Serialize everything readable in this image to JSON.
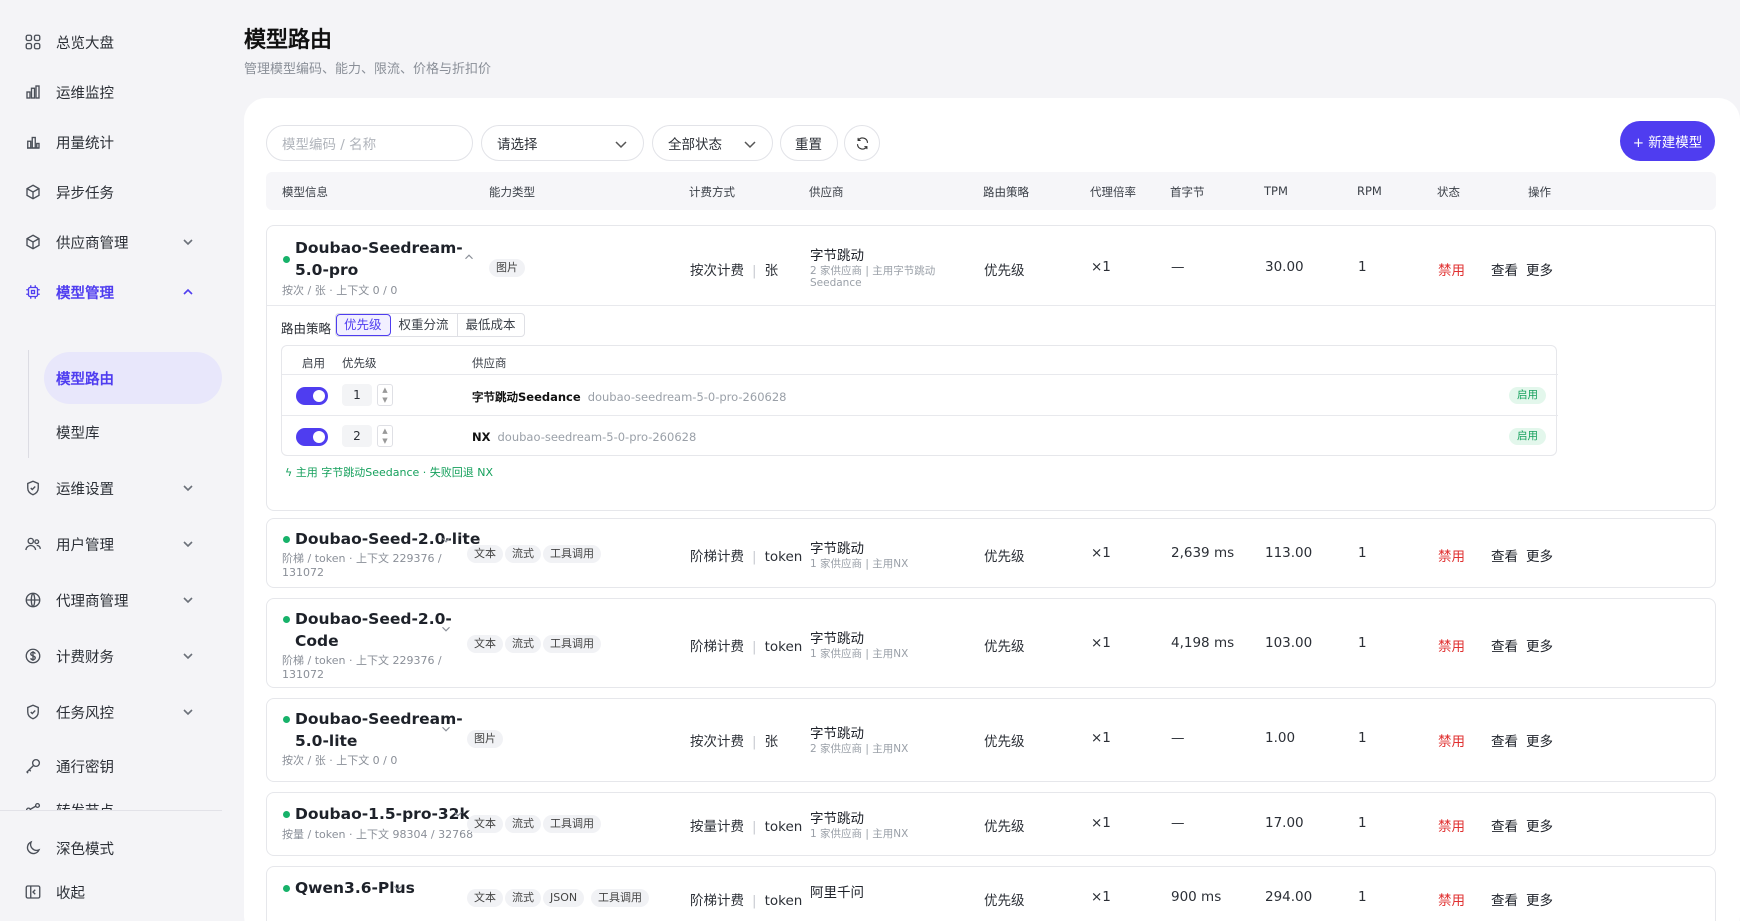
{
  "sidebar": {
    "items": [
      {
        "label": "总览大盘",
        "icon": "grid-icon"
      },
      {
        "label": "运维监控",
        "icon": "bar-chart-icon"
      },
      {
        "label": "用量统计",
        "icon": "stats-icon"
      },
      {
        "label": "异步任务",
        "icon": "box-icon"
      },
      {
        "label": "供应商管理",
        "icon": "box-icon"
      },
      {
        "label": "模型管理",
        "icon": "cpu-icon"
      },
      {
        "label": "运维设置",
        "icon": "shield-icon"
      },
      {
        "label": "用户管理",
        "icon": "users-icon"
      },
      {
        "label": "代理商管理",
        "icon": "globe-icon"
      },
      {
        "label": "计费财务",
        "icon": "dollar-icon"
      },
      {
        "label": "任务风控",
        "icon": "shield-icon"
      },
      {
        "label": "通行密钥",
        "icon": "key-icon"
      },
      {
        "label": "转发节点",
        "icon": "node-icon"
      }
    ],
    "sub_items": [
      {
        "label": "模型路由"
      },
      {
        "label": "模型库"
      }
    ],
    "dark_mode": "深色模式",
    "collapse": "收起",
    "accent": "#4f3df0"
  },
  "page": {
    "title": "模型路由",
    "subtitle": "管理模型编码、能力、限流、价格与折扣价"
  },
  "filters": {
    "search_placeholder": "模型编码 / 名称",
    "select": "请选择",
    "status": "全部状态",
    "reset": "重置",
    "new_model": "+ 新建模型"
  },
  "columns": [
    "模型信息",
    "能力类型",
    "计费方式",
    "供应商",
    "路由策略",
    "代理倍率",
    "首字节",
    "TPM",
    "RPM",
    "状态",
    "操作"
  ],
  "actions": {
    "view": "查看",
    "more": "更多"
  },
  "rows": [
    {
      "name_l1": "Doubao-Seedream-",
      "name_l2": "5.0-pro",
      "meta_l1": "按次 / 张 · 上下文 0 / 0",
      "meta_l2": "",
      "tags": [
        "图片"
      ],
      "billing": "按次计费",
      "unit": "张",
      "vendor": "字节跳动",
      "vendor_meta_l1": "2 家供应商  |  主用字节跳动",
      "vendor_meta_l2": "Seedance",
      "strategy": "优先级",
      "rate": "×1",
      "ttfb": "—",
      "tpm": "30.00",
      "rpm": "1",
      "status": "禁用"
    },
    {
      "name_l1": "Doubao-Seed-2.0-lite",
      "name_l2": "",
      "meta_l1": "阶梯 / token · 上下文 229376 /",
      "meta_l2": "131072",
      "tags": [
        "文本",
        "流式",
        "工具调用"
      ],
      "billing": "阶梯计费",
      "unit": "token",
      "vendor": "字节跳动",
      "vendor_meta_l1": "1 家供应商  |  主用NX",
      "vendor_meta_l2": "",
      "strategy": "优先级",
      "rate": "×1",
      "ttfb": "2,639 ms",
      "tpm": "113.00",
      "rpm": "1",
      "status": "禁用"
    },
    {
      "name_l1": "Doubao-Seed-2.0-",
      "name_l2": "Code",
      "meta_l1": "阶梯 / token · 上下文 229376 /",
      "meta_l2": "131072",
      "tags": [
        "文本",
        "流式",
        "工具调用"
      ],
      "billing": "阶梯计费",
      "unit": "token",
      "vendor": "字节跳动",
      "vendor_meta_l1": "1 家供应商  |  主用NX",
      "vendor_meta_l2": "",
      "strategy": "优先级",
      "rate": "×1",
      "ttfb": "4,198 ms",
      "tpm": "103.00",
      "rpm": "1",
      "status": "禁用"
    },
    {
      "name_l1": "Doubao-Seedream-",
      "name_l2": "5.0-lite",
      "meta_l1": "按次 / 张 · 上下文 0 / 0",
      "meta_l2": "",
      "tags": [
        "图片"
      ],
      "billing": "按次计费",
      "unit": "张",
      "vendor": "字节跳动",
      "vendor_meta_l1": "2 家供应商  |  主用NX",
      "vendor_meta_l2": "",
      "strategy": "优先级",
      "rate": "×1",
      "ttfb": "—",
      "tpm": "1.00",
      "rpm": "1",
      "status": "禁用"
    },
    {
      "name_l1": "Doubao-1.5-pro-32k",
      "name_l2": "",
      "meta_l1": "按量 / token · 上下文 98304 / 32768",
      "meta_l2": "",
      "tags": [
        "文本",
        "流式",
        "工具调用"
      ],
      "billing": "按量计费",
      "unit": "token",
      "vendor": "字节跳动",
      "vendor_meta_l1": "1 家供应商  |  主用NX",
      "vendor_meta_l2": "",
      "strategy": "优先级",
      "rate": "×1",
      "ttfb": "—",
      "tpm": "17.00",
      "rpm": "1",
      "status": "禁用"
    },
    {
      "name_l1": "Qwen3.6-Plus",
      "name_l2": "",
      "meta_l1": "",
      "meta_l2": "",
      "tags": [
        "文本",
        "流式",
        "JSON",
        "工具调用"
      ],
      "billing": "阶梯计费",
      "unit": "token",
      "vendor": "阿里千问",
      "vendor_meta_l1": "",
      "vendor_meta_l2": "",
      "strategy": "优先级",
      "rate": "×1",
      "ttfb": "900 ms",
      "tpm": "294.00",
      "rpm": "1",
      "status": "禁用"
    }
  ],
  "expanded": {
    "strategy_label": "路由策略",
    "options": [
      "优先级",
      "权重分流",
      "最低成本"
    ],
    "headers": [
      "启用",
      "优先级",
      "供应商"
    ],
    "vendors": [
      {
        "priority": "1",
        "name": "字节跳动Seedance",
        "model": "doubao-seedream-5-0-pro-260628",
        "badge": "启用",
        "enabled": true
      },
      {
        "priority": "2",
        "name": "NX",
        "model": "doubao-seedream-5-0-pro-260628",
        "badge": "启用",
        "enabled": true
      }
    ],
    "fallback": "主用 字节跳动Seedance · 失败回退 NX"
  }
}
